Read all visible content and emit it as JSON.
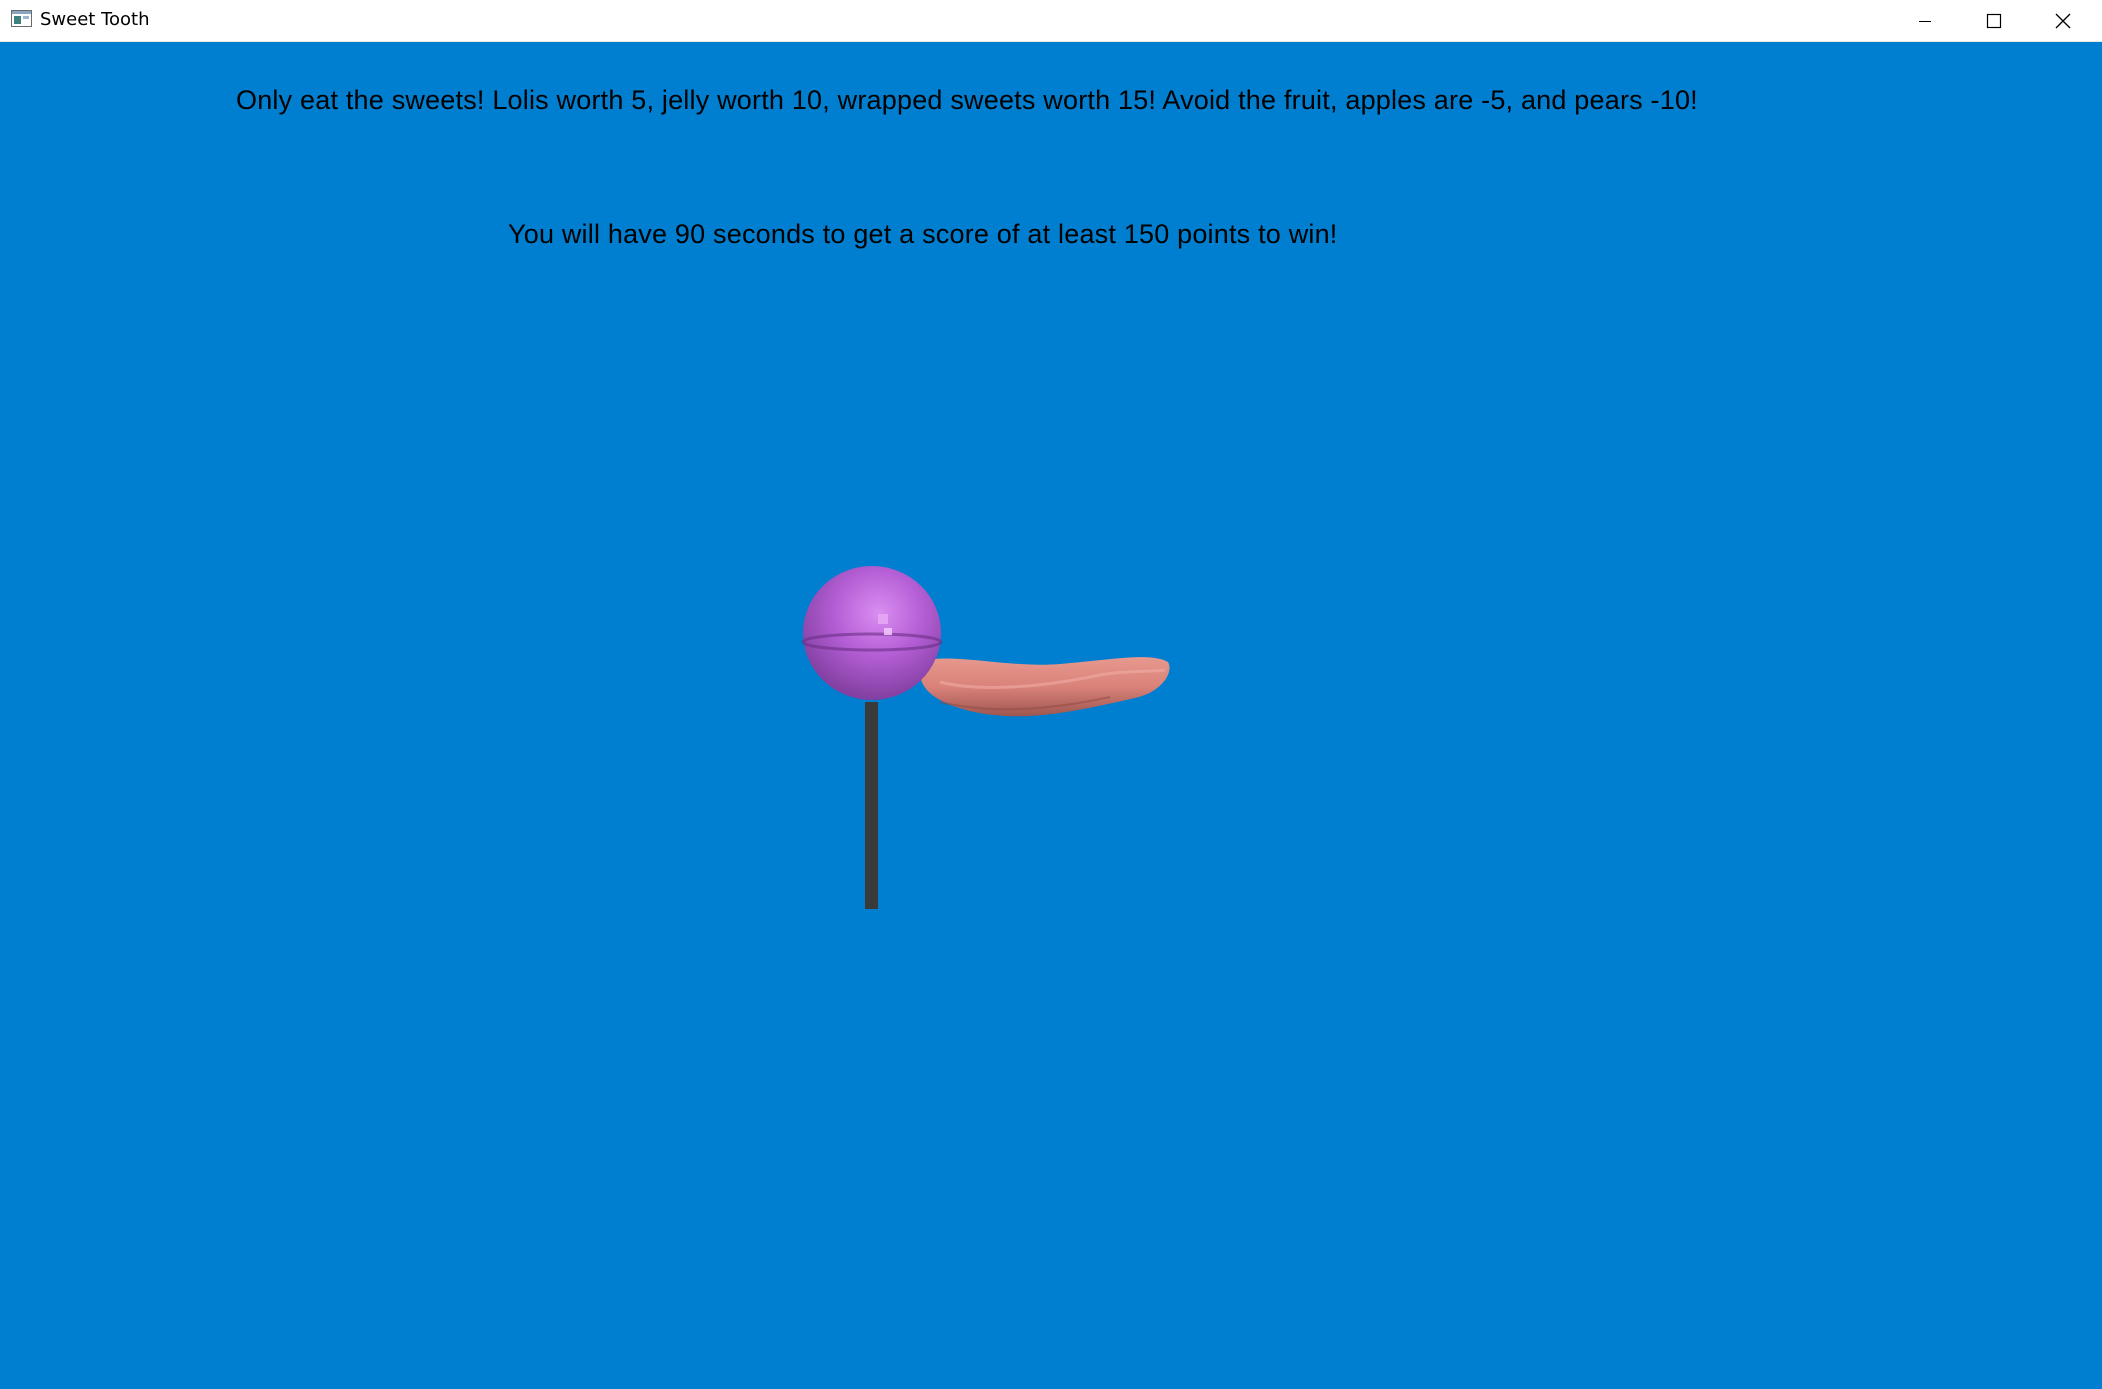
{
  "window": {
    "title": "Sweet Tooth",
    "icon": "app-window-icon",
    "controls": {
      "minimize_icon": "minimize-icon",
      "maximize_icon": "maximize-icon",
      "close_icon": "close-icon"
    }
  },
  "game": {
    "instructions": [
      "Only eat the sweets! Lolis worth 5, jelly worth 10, wrapped sweets worth 15! Avoid the fruit, apples are -5, and pears -10!",
      "You will have 90 seconds to get a score of at least 150 points to win!"
    ],
    "objects": [
      {
        "name": "lollipop",
        "color": "#b05ad0"
      },
      {
        "name": "jelly-worm",
        "color": "#d9827a"
      }
    ],
    "colors": {
      "background": "#007ecf",
      "text": "#000000"
    }
  }
}
